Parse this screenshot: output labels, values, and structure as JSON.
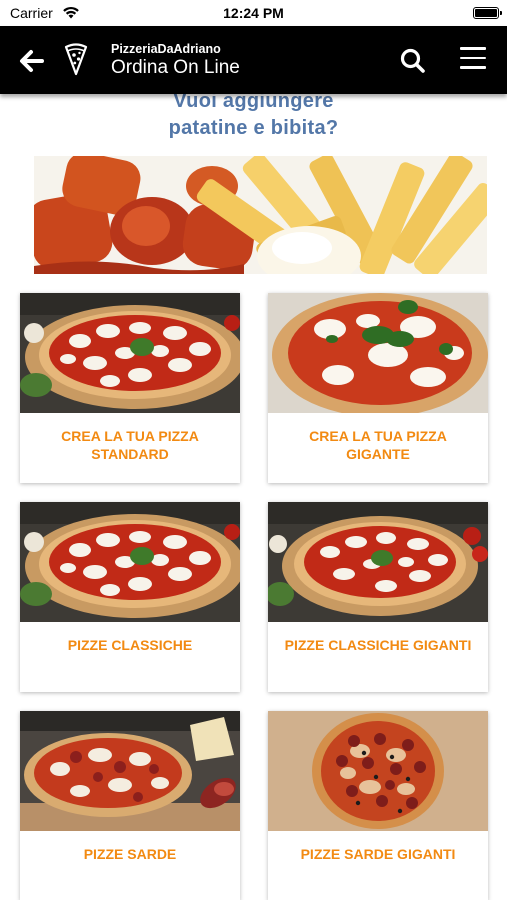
{
  "status_bar": {
    "carrier": "Carrier",
    "time": "12:24 PM"
  },
  "header": {
    "subtitle": "PizzeriaDaAdriano",
    "title": "Ordina On Line"
  },
  "promo": {
    "line1": "Vuoi aggiungere",
    "line2": "patatine e bibita?"
  },
  "cards": [
    {
      "label": "CREA LA TUA PIZZA STANDARD"
    },
    {
      "label": "CREA LA TUA PIZZA GIGANTE"
    },
    {
      "label": "PIZZE CLASSICHE"
    },
    {
      "label": "PIZZE CLASSICHE GIGANTI"
    },
    {
      "label": "PIZZE SARDE"
    },
    {
      "label": "PIZZE SARDE GIGANTI"
    }
  ],
  "colors": {
    "header_bg": "#000000",
    "accent": "#f28a12",
    "promo_text": "#5377a8"
  }
}
